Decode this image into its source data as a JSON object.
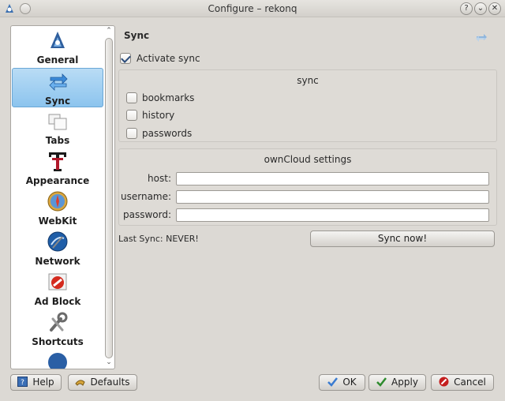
{
  "window": {
    "title": "Configure – rekonq"
  },
  "sidebar": {
    "items": [
      {
        "label": "General",
        "icon": "rekonq-logo-icon"
      },
      {
        "label": "Sync",
        "icon": "sync-arrows-icon",
        "selected": true
      },
      {
        "label": "Tabs",
        "icon": "tabs-icon"
      },
      {
        "label": "Appearance",
        "icon": "font-t-icon"
      },
      {
        "label": "WebKit",
        "icon": "compass-icon"
      },
      {
        "label": "Network",
        "icon": "network-globe-icon"
      },
      {
        "label": "Ad Block",
        "icon": "adblock-icon"
      },
      {
        "label": "Shortcuts",
        "icon": "tools-icon"
      }
    ]
  },
  "page": {
    "title": "Sync",
    "activate_sync": {
      "label": "Activate sync",
      "checked": true
    },
    "sync_group": {
      "title": "sync",
      "options": [
        {
          "label": "bookmarks",
          "checked": false
        },
        {
          "label": "history",
          "checked": false
        },
        {
          "label": "passwords",
          "checked": false
        }
      ]
    },
    "owncloud_group": {
      "title": "ownCloud settings",
      "host_label": "host:",
      "host_value": "",
      "username_label": "username:",
      "username_value": "",
      "password_label": "password:",
      "password_value": ""
    },
    "last_sync": "Last Sync: NEVER!",
    "sync_now": "Sync now!"
  },
  "buttons": {
    "help": "Help",
    "defaults": "Defaults",
    "ok": "OK",
    "apply": "Apply",
    "cancel": "Cancel"
  },
  "colors": {
    "selection": "#8cc4ee",
    "accent_ok": "#2e8b2e",
    "accent_cancel": "#c41e1e"
  }
}
